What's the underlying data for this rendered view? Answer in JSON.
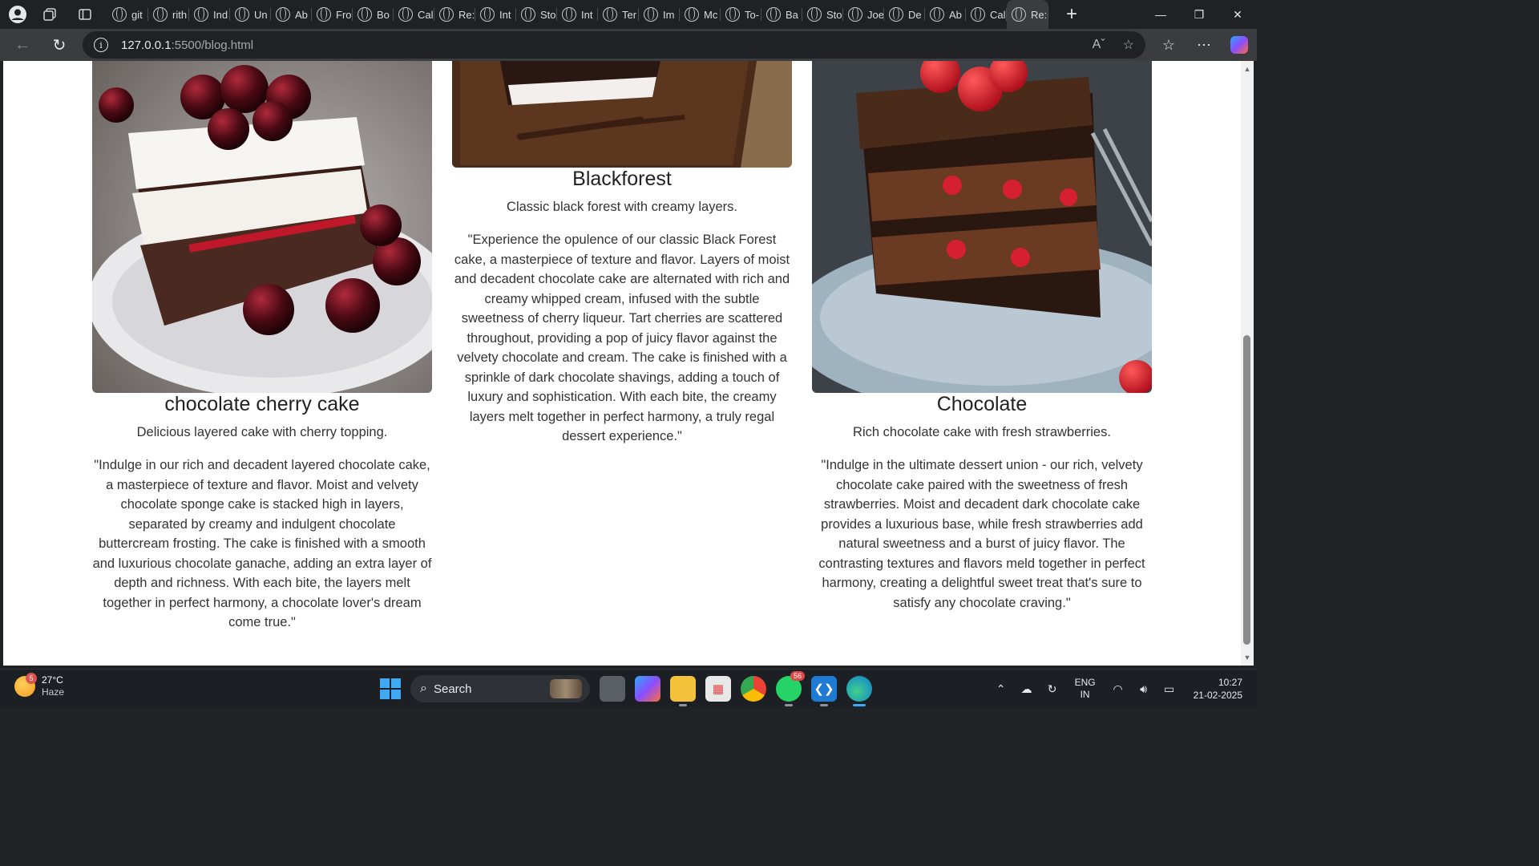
{
  "browser": {
    "tabs": [
      {
        "label": "git",
        "icon": "search-icon"
      },
      {
        "label": "rith",
        "icon": "github-icon"
      },
      {
        "label": "Ind",
        "icon": "globe-icon"
      },
      {
        "label": "Un",
        "icon": "globe-icon"
      },
      {
        "label": "Ab",
        "icon": "globe-icon"
      },
      {
        "label": "Fro",
        "icon": "frame-icon"
      },
      {
        "label": "Bo",
        "icon": "github-icon"
      },
      {
        "label": "Cal",
        "icon": "globe-icon"
      },
      {
        "label": "Re:",
        "icon": "globe-icon"
      },
      {
        "label": "Int",
        "icon": "globe-icon"
      },
      {
        "label": "Sto",
        "icon": "globe-icon"
      },
      {
        "label": "Int",
        "icon": "globe-icon"
      },
      {
        "label": "Ter",
        "icon": "globe-icon"
      },
      {
        "label": "Im",
        "icon": "globe-icon"
      },
      {
        "label": "Mc",
        "icon": "globe-icon"
      },
      {
        "label": "To-",
        "icon": "globe-icon"
      },
      {
        "label": "Ba",
        "icon": "globe-icon"
      },
      {
        "label": "Sto",
        "icon": "globe-icon"
      },
      {
        "label": "Joe",
        "icon": "globe-icon"
      },
      {
        "label": "De",
        "icon": "globe-icon"
      },
      {
        "label": "Ab",
        "icon": "globe-icon"
      },
      {
        "label": "Cal",
        "icon": "globe-icon"
      },
      {
        "label": "Re:",
        "icon": "globe-icon"
      }
    ],
    "active_tab_close": "×",
    "new_tab": "+",
    "url_host": "127.0.0.1",
    "url_path": ":5500/blog.html"
  },
  "cards": {
    "cherry": {
      "title": "chocolate cherry cake",
      "subtitle": "Delicious layered cake with cherry topping.",
      "description": "\"Indulge in our rich and decadent layered chocolate cake, a masterpiece of texture and flavor. Moist and velvety chocolate sponge cake is stacked high in layers, separated by creamy and indulgent chocolate buttercream frosting. The cake is finished with a smooth and luxurious chocolate ganache, adding an extra layer of depth and richness. With each bite, the layers melt together in perfect harmony, a chocolate lover's dream come true.\""
    },
    "blackforest": {
      "title": "Blackforest",
      "subtitle": "Classic black forest with creamy layers.",
      "description": "\"Experience the opulence of our classic Black Forest cake, a masterpiece of texture and flavor. Layers of moist and decadent chocolate cake are alternated with rich and creamy whipped cream, infused with the subtle sweetness of cherry liqueur. Tart cherries are scattered throughout, providing a pop of juicy flavor against the velvety chocolate and cream. The cake is finished with a sprinkle of dark chocolate shavings, adding a touch of luxury and sophistication. With each bite, the creamy layers melt together in perfect harmony, a truly regal dessert experience.\""
    },
    "chocolate": {
      "title": "Chocolate",
      "subtitle": "Rich chocolate cake with fresh strawberries.",
      "description": "\"Indulge in the ultimate dessert union - our rich, velvety chocolate cake paired with the sweetness of fresh strawberries. Moist and decadent dark chocolate cake provides a luxurious base, while fresh strawberries add natural sweetness and a burst of juicy flavor. The contrasting textures and flavors meld together in perfect harmony, creating a delightful sweet treat that's sure to satisfy any chocolate craving.\""
    }
  },
  "taskbar": {
    "weather_temp": "27°C",
    "weather_desc": "Haze",
    "weather_badge": "5",
    "search_label": "Search",
    "whatsapp_count": "56",
    "lang_1": "ENG",
    "lang_2": "IN",
    "time": "10:27",
    "date": "21-02-2025"
  },
  "colors": {
    "chrome_dark": "#202124",
    "toolbar": "#3a3c40",
    "taskbar": "#1c2024",
    "accent": "#3fa9f5"
  }
}
